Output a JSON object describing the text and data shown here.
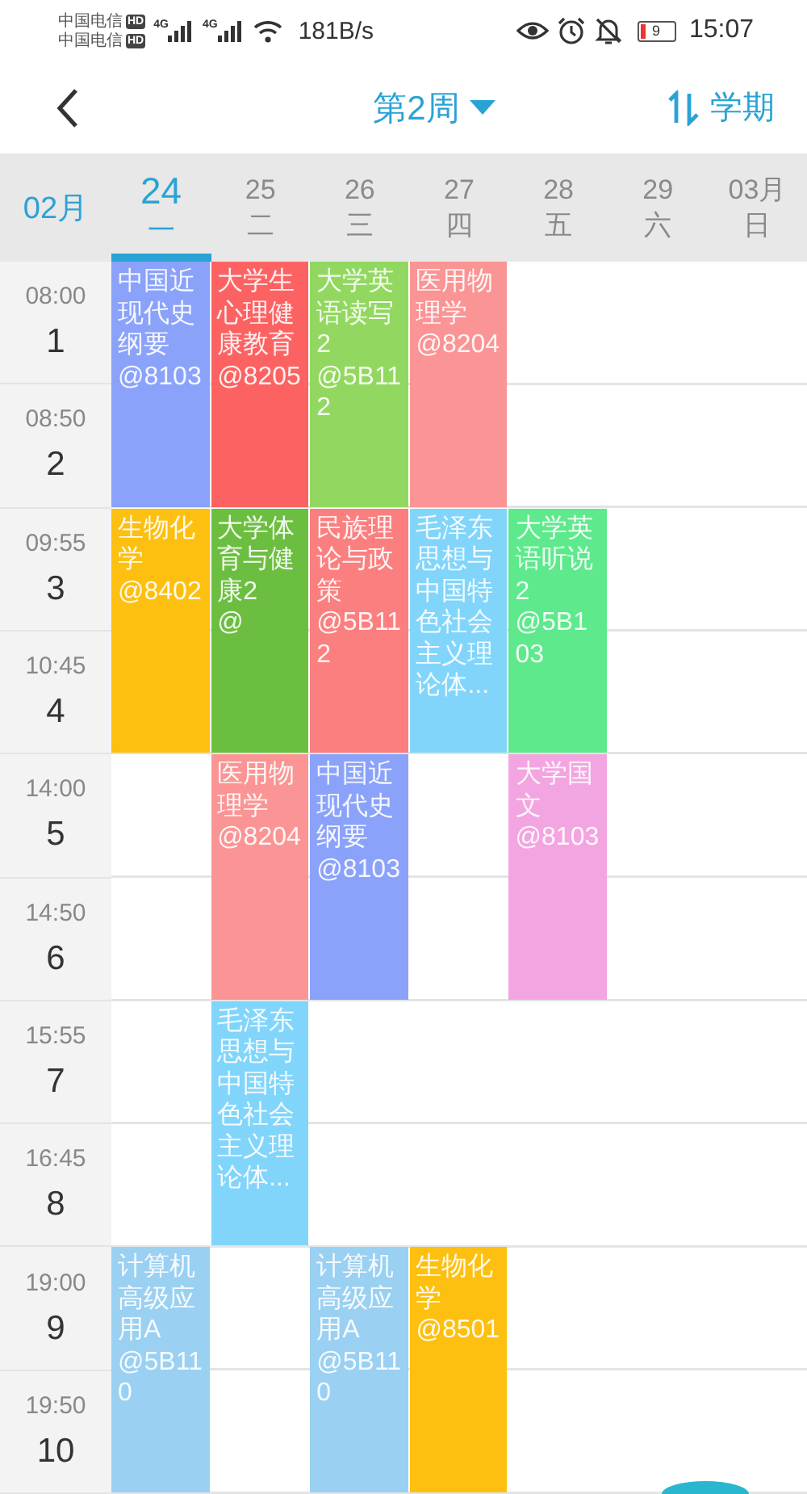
{
  "status_bar": {
    "carriers": [
      {
        "name": "中国电信",
        "badge": "HD"
      },
      {
        "name": "中国电信",
        "badge": "HD"
      }
    ],
    "signal_labels": [
      "4G",
      "4G"
    ],
    "speed": "181B/s",
    "battery": "9",
    "time": "15:07"
  },
  "header": {
    "title": "第2周",
    "right_label": "学期"
  },
  "month": "02月",
  "days": [
    {
      "date": "24",
      "weekday": "一",
      "selected": true
    },
    {
      "date": "25",
      "weekday": "二",
      "selected": false
    },
    {
      "date": "26",
      "weekday": "三",
      "selected": false
    },
    {
      "date": "27",
      "weekday": "四",
      "selected": false
    },
    {
      "date": "28",
      "weekday": "五",
      "selected": false
    },
    {
      "date": "29",
      "weekday": "六",
      "selected": false
    },
    {
      "date": "03月",
      "weekday": "日",
      "selected": false
    }
  ],
  "periods": [
    {
      "time": "08:00",
      "number": "1"
    },
    {
      "time": "08:50",
      "number": "2"
    },
    {
      "time": "09:55",
      "number": "3"
    },
    {
      "time": "10:45",
      "number": "4"
    },
    {
      "time": "14:00",
      "number": "5"
    },
    {
      "time": "14:50",
      "number": "6"
    },
    {
      "time": "15:55",
      "number": "7"
    },
    {
      "time": "16:45",
      "number": "8"
    },
    {
      "time": "19:00",
      "number": "9"
    },
    {
      "time": "19:50",
      "number": "10"
    }
  ],
  "sessions": [
    {
      "cells": [
        {
          "kind": "course",
          "name": "中国近现代史纲要",
          "room": "@8103",
          "color": "#8aa2fa"
        },
        {
          "kind": "course",
          "name": "大学生心理健康教育",
          "room": "@8205",
          "color": "#fd6262"
        },
        {
          "kind": "course",
          "name": "大学英语读写2",
          "room": "@5B112",
          "color": "#92d860"
        },
        {
          "kind": "course",
          "name": "医用物理学",
          "room": "@8204",
          "color": "#fb9494"
        }
      ]
    },
    {
      "cells": [
        {
          "kind": "course",
          "name": "生物化学",
          "room": "@8402",
          "color": "#fdbf10"
        },
        {
          "kind": "course",
          "name": "大学体育与健康2",
          "room": "@",
          "color": "#6cbe40"
        },
        {
          "kind": "course",
          "name": "民族理论与政策",
          "room": "@5B112",
          "color": "#fb7f7f"
        },
        {
          "kind": "course",
          "name": "毛泽东思想与中国特色社会主义理论体...",
          "color": "#82d5fa"
        },
        {
          "kind": "course",
          "name": "大学英语听说2",
          "room": "@5B103",
          "color": "#5ee98c"
        }
      ]
    },
    {
      "cells": [
        {
          "kind": "empty"
        },
        {
          "kind": "course",
          "name": "医用物理学",
          "room": "@8204",
          "color": "#fb9494"
        },
        {
          "kind": "course",
          "name": "中国近现代史纲要",
          "room": "@8103",
          "color": "#8aa2fa"
        },
        {
          "kind": "empty"
        },
        {
          "kind": "course",
          "name": "大学国文",
          "room": "@8103",
          "color": "#f3a5e1"
        }
      ]
    },
    {
      "cells": [
        {
          "kind": "empty"
        },
        {
          "kind": "course",
          "name": "毛泽东思想与中国特色社会主义理论体...",
          "color": "#82d5fa"
        }
      ]
    },
    {
      "cells": [
        {
          "kind": "course",
          "name": "计算机高级应用A",
          "room": "@5B110",
          "color": "#9ad0f2"
        },
        {
          "kind": "empty"
        },
        {
          "kind": "course",
          "name": "计算机高级应用A",
          "room": "@5B110",
          "color": "#9ad0f2"
        },
        {
          "kind": "course",
          "name": "生物化学",
          "room": "@8501",
          "color": "#fdc010"
        }
      ]
    }
  ]
}
